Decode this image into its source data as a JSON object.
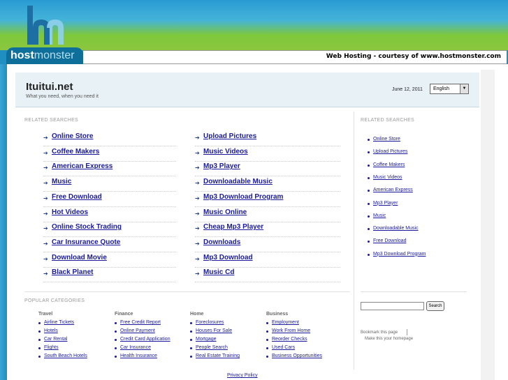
{
  "brand": {
    "logo_text_bold": "host",
    "logo_text_light": "monster",
    "tagline": "Web Hosting - courtesy of www.hostmonster.com"
  },
  "header": {
    "title": "Ituitui.net",
    "subtitle": "What you need, when you need it",
    "date": "June 12, 2011",
    "language": "English"
  },
  "related_searches_heading": "RELATED SEARCHES",
  "main_searches": {
    "col1": [
      "Online Store",
      "Coffee Makers",
      "American Express",
      "Music",
      "Free Download",
      "Hot Videos",
      "Online Stock Trading",
      "Car Insurance Quote",
      "Download Movie",
      "Black Planet"
    ],
    "col2": [
      "Upload Pictures",
      "Music Videos",
      "Mp3 Player",
      "Downloadable Music",
      "Mp3 Download Program",
      "Music Online",
      "Cheap Mp3 Player",
      "Downloads",
      "Mp3 Download",
      "Music Cd"
    ]
  },
  "right_searches": [
    "Online Store",
    "Upload Pictures",
    "Coffee Makers",
    "Music Videos",
    "American Express",
    "Mp3 Player",
    "Music",
    "Downloadable Music",
    "Free Download",
    "Mp3 Download Program"
  ],
  "popular_heading": "POPULAR CATEGORIES",
  "categories": [
    {
      "name": "Travel",
      "links": [
        "Airline Tickets",
        "Hotels",
        "Car Rental",
        "Flights",
        "South Beach Hotels"
      ]
    },
    {
      "name": "Finance",
      "links": [
        "Free Credit Report",
        "Online Payment",
        "Credit Card Application",
        "Car Insurance",
        "Health Insurance"
      ]
    },
    {
      "name": "Home",
      "links": [
        "Foreclosures",
        "Houses For Sale",
        "Mortgage",
        "People Search",
        "Real Estate Training"
      ]
    },
    {
      "name": "Business",
      "links": [
        "Employment",
        "Work From Home",
        "Reorder Checks",
        "Used Cars",
        "Business Opportunities"
      ]
    }
  ],
  "search": {
    "button": "Search",
    "placeholder": ""
  },
  "bookmark": "Bookmark this page",
  "homepage": "Make this your homepage",
  "privacy": "Privacy Policy"
}
